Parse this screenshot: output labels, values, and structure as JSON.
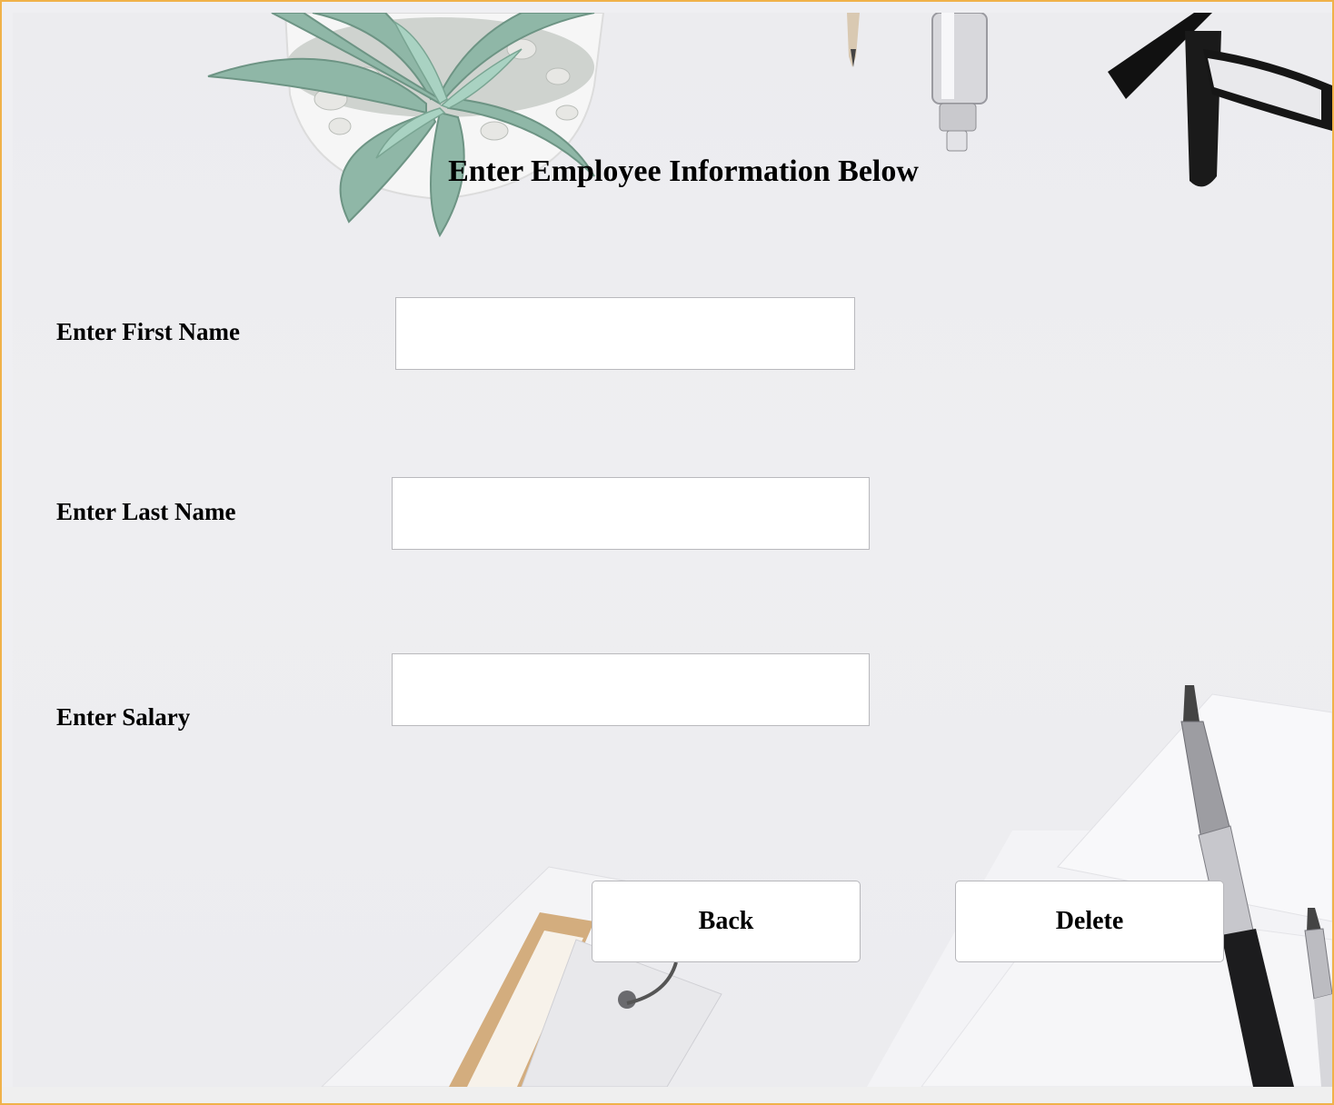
{
  "form": {
    "title": "Enter Employee Information Below",
    "fields": [
      {
        "label": "Enter First Name",
        "value": "",
        "placeholder": ""
      },
      {
        "label": "Enter Last Name",
        "value": "",
        "placeholder": ""
      },
      {
        "label": "Enter Salary",
        "value": "",
        "placeholder": ""
      }
    ]
  },
  "buttons": {
    "back_label": "Back",
    "delete_label": "Delete"
  },
  "colors": {
    "window_border": "#f0b24a",
    "background": "#ececef",
    "field_background": "#ffffff",
    "text": "#000000"
  },
  "background_image": {
    "objects": [
      "succulent-plant",
      "pencil",
      "pen",
      "eyeglasses",
      "mechanical-pencils",
      "notepad-ring",
      "paper-stack"
    ]
  }
}
